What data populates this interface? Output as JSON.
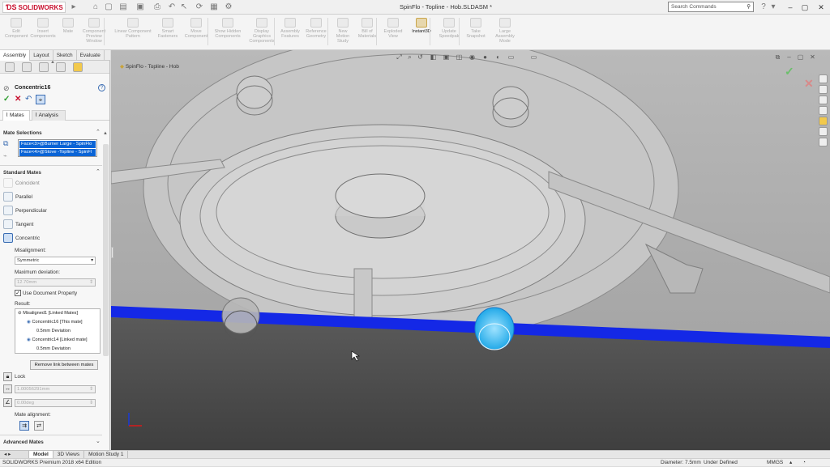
{
  "titlebar": {
    "app_name": "SOLIDWORKS",
    "doc_title": "SpinFlo - Topline - Hob.SLDASM *",
    "search_placeholder": "Search Commands"
  },
  "commands": [
    {
      "label": "Edit Component"
    },
    {
      "label": "Insert Components"
    },
    {
      "label": "Mate"
    },
    {
      "label": "Component Preview Window"
    },
    {
      "label": "Linear Component Pattern"
    },
    {
      "label": "Smart Fasteners"
    },
    {
      "label": "Move Component"
    },
    {
      "label": "Show Hidden Components"
    },
    {
      "label": "Display Graphics Components"
    },
    {
      "label": "Assembly Features"
    },
    {
      "label": "Reference Geometry"
    },
    {
      "label": "New Motion Study"
    },
    {
      "label": "Bill of Materials"
    },
    {
      "label": "Exploded View"
    },
    {
      "label": "Instant3D"
    },
    {
      "label": "Update Speedpak"
    },
    {
      "label": "Take Snapshot"
    },
    {
      "label": "Large Assembly Mode"
    }
  ],
  "cm_tabs": [
    "Assembly",
    "Layout",
    "Sketch",
    "Evaluate"
  ],
  "breadcrumb": "SpinFlo - Topline - Hob",
  "panel": {
    "title": "Concentric16",
    "subtabs": [
      "Mates",
      "Analysis"
    ],
    "mate_selections_header": "Mate Selections",
    "selections": [
      "Face<3>@Burner Large - SpinFlo",
      "Face<4>@Stove -Topline - SpinFl"
    ],
    "standard_mates_header": "Standard Mates",
    "mates": [
      "Coincident",
      "Parallel",
      "Perpendicular",
      "Tangent",
      "Concentric"
    ],
    "misalignment_label": "Misalignment:",
    "misalignment_value": "Symmetric",
    "max_deviation_label": "Maximum deviation:",
    "max_deviation_value": "12.70mm",
    "use_doc_property": "Use Document Property",
    "result_label": "Result:",
    "result_tree": [
      "Misaligned1 [Linked Mates]",
      "Concentric16 [This mate]",
      "0.5mm Deviation",
      "Concentric14 [Linked mate]",
      "0.5mm Deviation"
    ],
    "remove_link_button": "Remove link between mates",
    "lock_label": "Lock",
    "distance_value": "1.00056291mm",
    "angle_value": "0.00deg",
    "mate_alignment_label": "Mate alignment:",
    "advanced_mates_header": "Advanced Mates"
  },
  "bottom_tabs": [
    "Model",
    "3D Views",
    "Motion Study 1"
  ],
  "status": {
    "edition": "SOLIDWORKS Premium 2018 x64 Edition",
    "diameter": "Diameter: 7.5mm",
    "definition": "Under Defined",
    "units": "MMGS"
  },
  "colors": {
    "selection_blue": "#0a64d6",
    "highlight_bar": "#1428e6",
    "accept_green": "#2e9e2e",
    "cancel_red": "#c8102e"
  }
}
